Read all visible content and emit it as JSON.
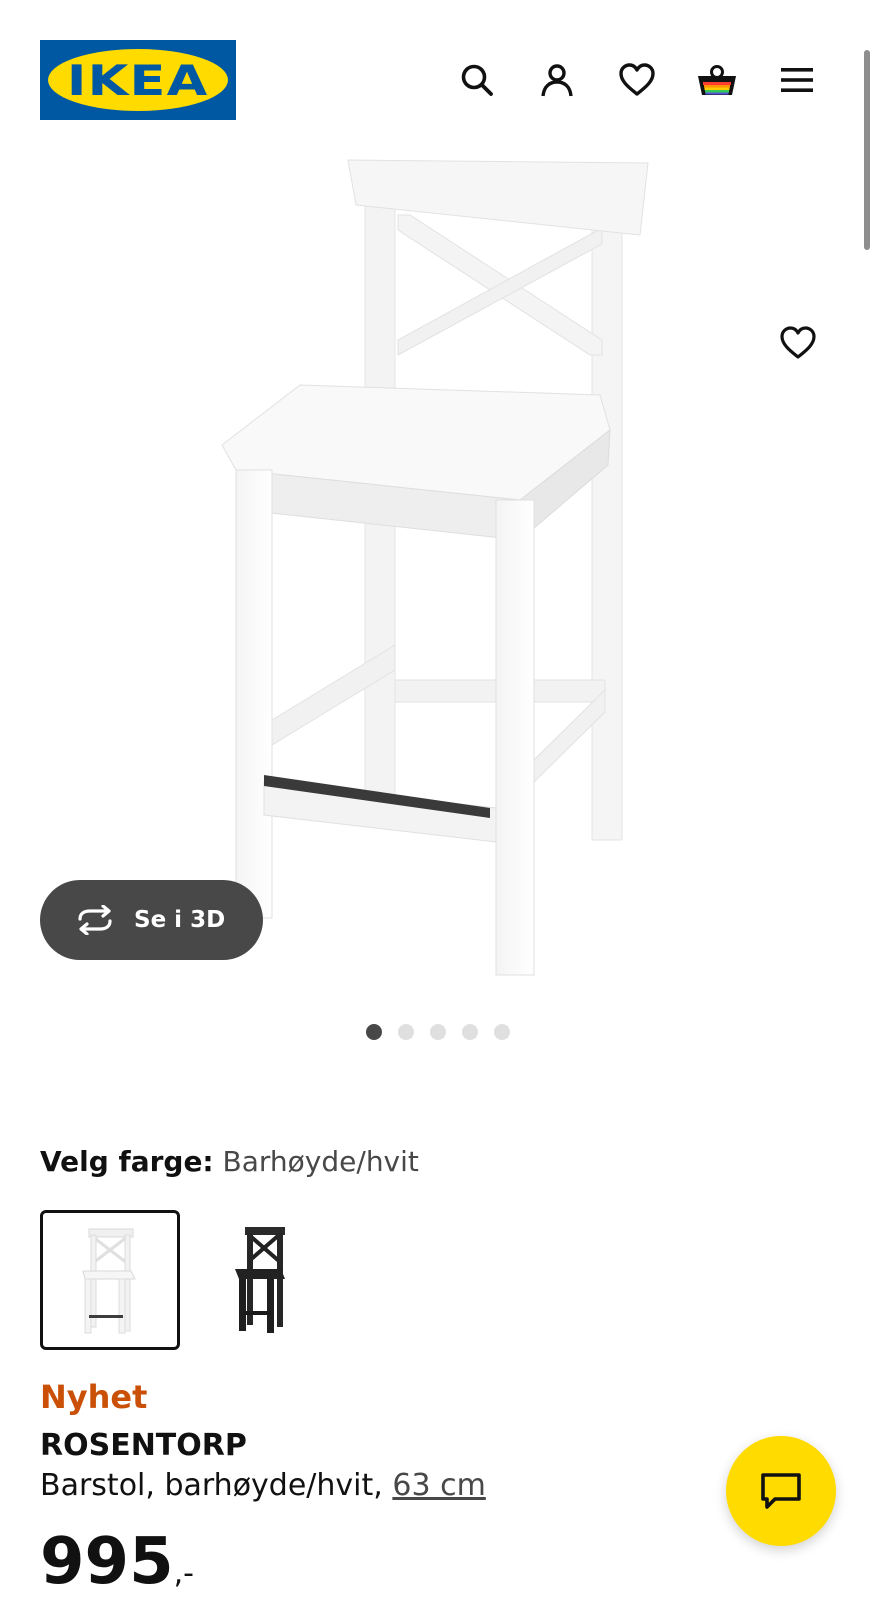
{
  "header": {
    "logo_text": "IKEA",
    "icons": [
      "search-icon",
      "user-icon",
      "heart-icon",
      "basket-icon",
      "menu-icon"
    ]
  },
  "gallery": {
    "see3d_label": "Se i 3D",
    "image_count": 5,
    "active_image": 1
  },
  "color": {
    "label": "Velg farge:",
    "value": "Barhøyde/hvit",
    "options": [
      "white",
      "black"
    ],
    "selected": "white"
  },
  "product": {
    "badge": "Nyhet",
    "name": "ROSENTORP",
    "description": "Barstol, barhøyde/hvit,",
    "size_link": "63 cm",
    "price": "995",
    "price_suffix": ",-"
  },
  "colors": {
    "ikea_blue": "#0058a3",
    "ikea_yellow": "#ffdb00",
    "new_badge": "#ca5008",
    "dark_grey": "#484848"
  }
}
